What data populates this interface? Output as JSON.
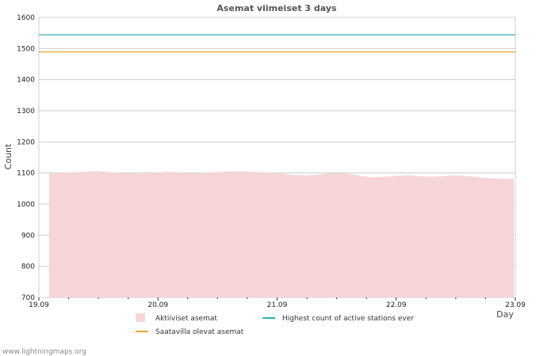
{
  "chart_data": {
    "type": "area",
    "title": "Asemat viimeiset 3 days",
    "xlabel": "Day",
    "ylabel": "Count",
    "ylim": [
      700,
      1600
    ],
    "yticks": [
      700,
      800,
      900,
      1000,
      1100,
      1200,
      1300,
      1400,
      1500,
      1600
    ],
    "xlim": [
      "19.09",
      "23.09"
    ],
    "xticks": [
      "19.09",
      "20.09",
      "21.09",
      "22.09",
      "23.09"
    ],
    "grid": true,
    "legend_position": "bottom",
    "series": [
      {
        "name": "Aktiiviset asemat",
        "kind": "area",
        "color": "#f5d5d6",
        "x": [
          0.0,
          0.1,
          0.2,
          0.3,
          0.4,
          0.5,
          0.6,
          0.7,
          0.8,
          0.9,
          1.0,
          1.1,
          1.2,
          1.3,
          1.4,
          1.5,
          1.6,
          1.7,
          1.8,
          1.9,
          2.0,
          2.1,
          2.2,
          2.3,
          2.4,
          2.5,
          2.6,
          2.7,
          2.8,
          2.9,
          3.0,
          3.1,
          3.2,
          3.3,
          3.4,
          3.5,
          3.6,
          3.7,
          3.8,
          3.9,
          4.0
        ],
        "values": [
          1099,
          1100,
          1102,
          1104,
          1106,
          1103,
          1101,
          1099,
          1097,
          1100,
          1104,
          1102,
          1100,
          1099,
          1102,
          1104,
          1106,
          1105,
          1103,
          1101,
          1098,
          1094,
          1092,
          1094,
          1098,
          1100,
          1096,
          1089,
          1086,
          1088,
          1091,
          1093,
          1089,
          1088,
          1090,
          1092,
          1090,
          1086,
          1083,
          1081,
          1082
        ]
      },
      {
        "name": "Highest count of active stations ever",
        "kind": "line",
        "color": "#2ab0b4",
        "values": [
          1544
        ]
      },
      {
        "name": "Saatavilla olevat asemat",
        "kind": "line",
        "color": "#e6a42c",
        "values": [
          1489
        ]
      }
    ]
  },
  "footer": "www.lightningmaps.org"
}
